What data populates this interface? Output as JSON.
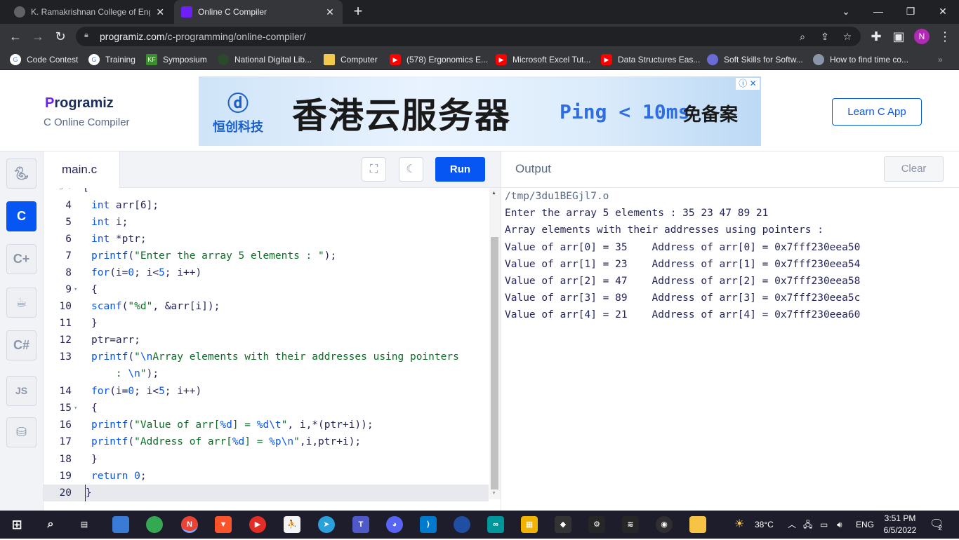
{
  "browser": {
    "tabs": [
      {
        "title": "K. Ramakrishnan College of Engin",
        "close": "✕"
      },
      {
        "title": "Online C Compiler",
        "close": "✕"
      }
    ],
    "new_tab": "+",
    "url_domain": "programiz.com",
    "url_path": "/c-programming/online-compiler/",
    "profile_initial": "N",
    "bookmarks": [
      "Code Contest",
      "Training",
      "Symposium",
      "National Digital Lib...",
      "Computer",
      "(578) Ergonomics E...",
      "Microsoft Excel Tut...",
      "Data Structures Eas...",
      "Soft Skills for Softw...",
      "How to find time co..."
    ]
  },
  "site": {
    "logo_p": "P",
    "logo_rest": "rogramiz",
    "subtitle": "C Online Compiler",
    "ad_brand": "恒创科技",
    "ad_title": "香港云服务器",
    "ad_ping": "Ping < 10ms",
    "ad_ping2": "免备案",
    "learn_button": "Learn C App"
  },
  "languages": [
    "python",
    "c",
    "cpp",
    "java",
    "csharp",
    "js",
    "sql"
  ],
  "editor": {
    "file_name": "main.c",
    "run_label": "Run",
    "lines": [
      {
        "n": "4",
        "text": "int arr[6];"
      },
      {
        "n": "5",
        "text": "int i;"
      },
      {
        "n": "6",
        "text": "int *ptr;"
      },
      {
        "n": "7",
        "text": "printf(\"Enter the array 5 elements : \");"
      },
      {
        "n": "8",
        "text": "for(i=0; i<5; i++)"
      },
      {
        "n": "9",
        "text": "{"
      },
      {
        "n": "10",
        "text": "scanf(\"%d\", &arr[i]);"
      },
      {
        "n": "11",
        "text": "}"
      },
      {
        "n": "12",
        "text": "ptr=arr;"
      },
      {
        "n": "13",
        "text": "printf(\"\\nArray elements with their addresses using pointers"
      },
      {
        "n": "",
        "text": "    : \\n\");"
      },
      {
        "n": "14",
        "text": "for(i=0; i<5; i++)"
      },
      {
        "n": "15",
        "text": "{"
      },
      {
        "n": "16",
        "text": "printf(\"Value of arr[%d] = %d\\t\", i,*(ptr+i));"
      },
      {
        "n": "17",
        "text": "printf(\"Address of arr[%d] = %p\\n\",i,ptr+i);"
      },
      {
        "n": "18",
        "text": "}"
      },
      {
        "n": "19",
        "text": "return 0;"
      },
      {
        "n": "20",
        "text": "}"
      }
    ]
  },
  "output": {
    "title": "Output",
    "clear_label": "Clear",
    "lines": [
      "/tmp/3du1BEGjl7.o",
      "Enter the array 5 elements : 35 23 47 89 21",
      "Array elements with their addresses using pointers :",
      "Value of arr[0] = 35    Address of arr[0] = 0x7fff230eea50",
      "Value of arr[1] = 23    Address of arr[1] = 0x7fff230eea54",
      "Value of arr[2] = 47    Address of arr[2] = 0x7fff230eea58",
      "Value of arr[3] = 89    Address of arr[3] = 0x7fff230eea5c",
      "Value of arr[4] = 21    Address of arr[4] = 0x7fff230eea60"
    ]
  },
  "taskbar": {
    "weather": "38°C",
    "language": "ENG",
    "time": "3:51 PM",
    "date": "6/5/2022",
    "notifications": "2"
  },
  "colors": {
    "accent": "#0556f3",
    "code_text": "#25265e",
    "keyword": "#0556f3",
    "string": "#0e6e27"
  }
}
